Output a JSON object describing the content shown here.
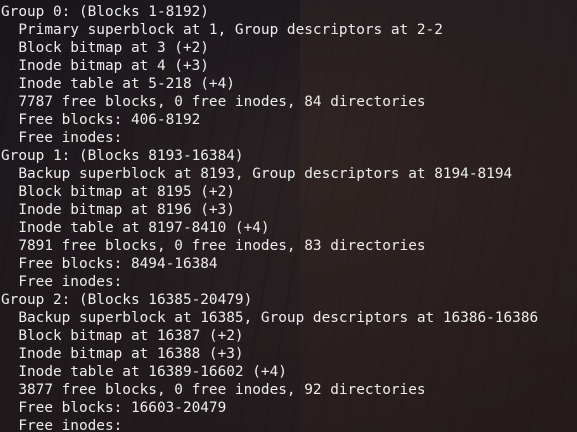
{
  "terminal": {
    "lines": [
      "Group 0: (Blocks 1-8192)",
      "  Primary superblock at 1, Group descriptors at 2-2",
      "  Block bitmap at 3 (+2)",
      "  Inode bitmap at 4 (+3)",
      "  Inode table at 5-218 (+4)",
      "  7787 free blocks, 0 free inodes, 84 directories",
      "  Free blocks: 406-8192",
      "  Free inodes:",
      "Group 1: (Blocks 8193-16384)",
      "  Backup superblock at 8193, Group descriptors at 8194-8194",
      "  Block bitmap at 8195 (+2)",
      "  Inode bitmap at 8196 (+3)",
      "  Inode table at 8197-8410 (+4)",
      "  7891 free blocks, 0 free inodes, 83 directories",
      "  Free blocks: 8494-16384",
      "  Free inodes:",
      "Group 2: (Blocks 16385-20479)",
      "  Backup superblock at 16385, Group descriptors at 16386-16386",
      "  Block bitmap at 16387 (+2)",
      "  Inode bitmap at 16388 (+3)",
      "  Inode table at 16389-16602 (+4)",
      "  3877 free blocks, 0 free inodes, 92 directories",
      "  Free blocks: 16603-20479",
      "  Free inodes:"
    ]
  }
}
